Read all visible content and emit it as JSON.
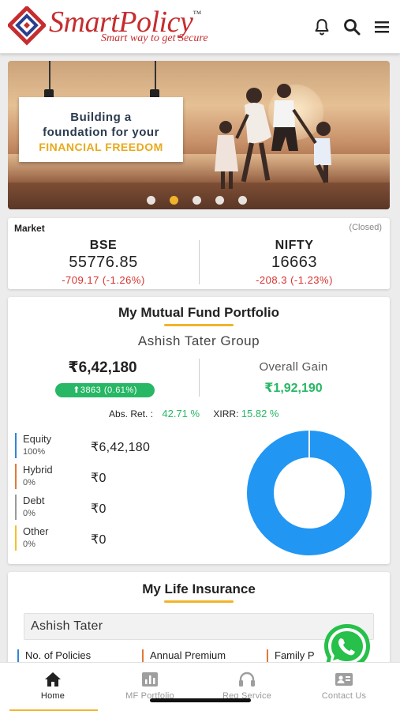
{
  "header": {
    "brand_name": "SmartPolicy",
    "trademark": "™",
    "tagline": "Smart way to get Secure",
    "icons": [
      "bell-icon",
      "search-icon",
      "menu-icon"
    ]
  },
  "banner": {
    "line1": "Building a",
    "line2": "foundation for your",
    "line3": "FINANCIAL FREEDOM",
    "slide_count": 5,
    "active_slide": 2
  },
  "market": {
    "label": "Market",
    "status": "(Closed)",
    "bse": {
      "name": "BSE",
      "value": "55776.85",
      "change": "-709.17",
      "change_pct": "(-1.26%)"
    },
    "nifty": {
      "name": "NIFTY",
      "value": "16663",
      "change": "-208.3",
      "change_pct": "(-1.23%)"
    }
  },
  "mutual_fund": {
    "title": "My Mutual Fund Portfolio",
    "group": "Ashish Tater Group",
    "total": "₹6,42,180",
    "day_change": "⬆3863 (0.61%)",
    "gain_label": "Overall Gain",
    "gain_value": "₹1,92,190",
    "abs_ret_label": "Abs. Ret. :",
    "abs_ret_value": "42.71 %",
    "xirr_label": "XIRR:",
    "xirr_value": "15.82 %",
    "allocations": [
      {
        "name": "Equity",
        "pct": "100%",
        "amount": "₹6,42,180",
        "color": "#2f86d6",
        "share": 1.0
      },
      {
        "name": "Hybrid",
        "pct": "0%",
        "amount": "₹0",
        "color": "#e07a3a",
        "share": 0
      },
      {
        "name": "Debt",
        "pct": "0%",
        "amount": "₹0",
        "color": "#9a9a9a",
        "share": 0
      },
      {
        "name": "Other",
        "pct": "0%",
        "amount": "₹0",
        "color": "#f2c12e",
        "share": 0
      }
    ],
    "donut_color": "#2196f3"
  },
  "life_insurance": {
    "title": "My Life Insurance",
    "selected_member": "Ashish Tater",
    "columns": [
      {
        "label": "No. of Policies",
        "color": "#2f86d6"
      },
      {
        "label": "Annual Premium",
        "color": "#e07a3a"
      },
      {
        "label": "Family P",
        "color": "#e07a3a"
      }
    ]
  },
  "bottom_nav": {
    "items": [
      {
        "label": "Home",
        "icon": "home-icon",
        "active": true
      },
      {
        "label": "MF Portfolio",
        "icon": "chart-icon",
        "active": false
      },
      {
        "label": "Req Service",
        "icon": "headset-icon",
        "active": false
      },
      {
        "label": "Contact Us",
        "icon": "contact-card-icon",
        "active": false
      }
    ]
  },
  "colors": {
    "brand_red": "#c62d2f",
    "accent_yellow": "#f2b327",
    "gain_green": "#27b765",
    "loss_red": "#d9302c"
  }
}
